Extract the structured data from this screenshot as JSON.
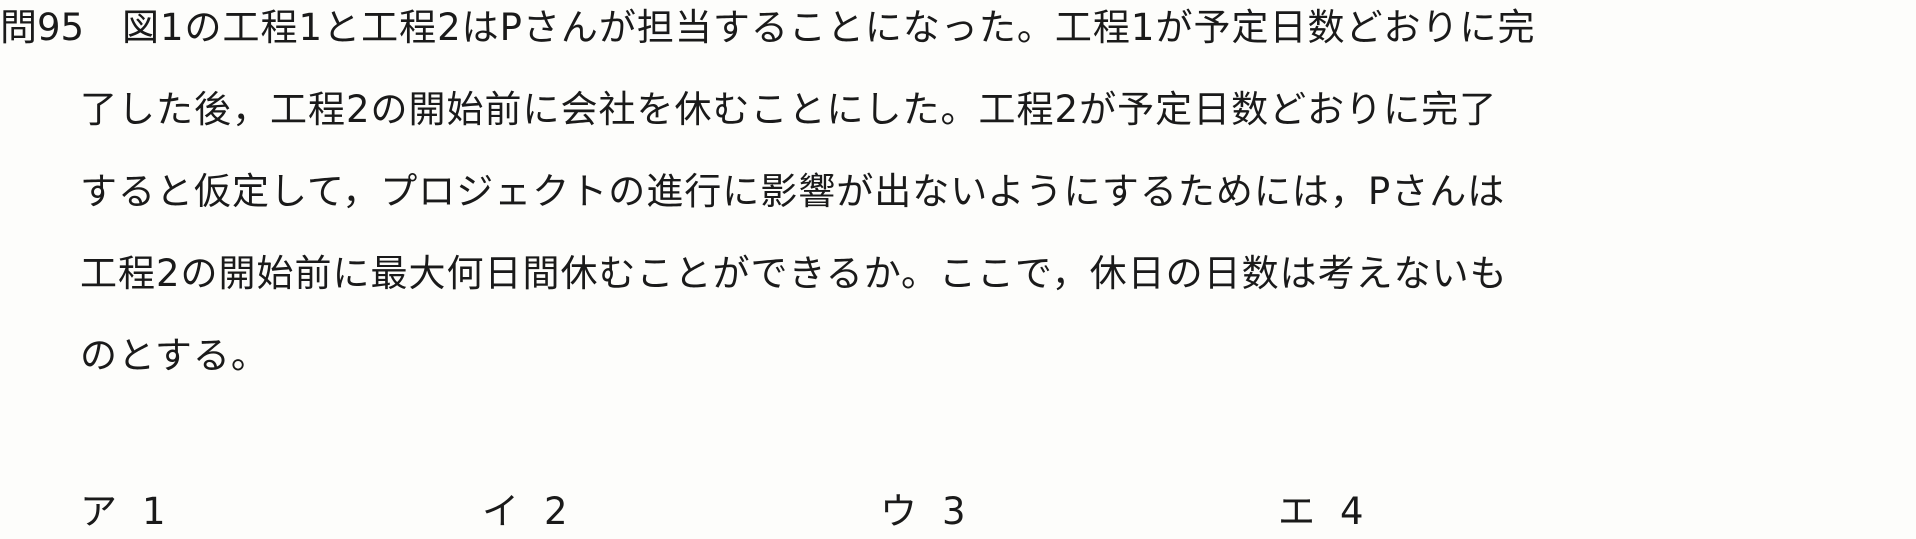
{
  "question": {
    "number": "問95",
    "lines": [
      "図1の工程1と工程2はPさんが担当することになった。工程1が予定日数どおりに完",
      "了した後，工程2の開始前に会社を休むことにした。工程2が予定日数どおりに完了",
      "すると仮定して，プロジェクトの進行に影響が出ないようにするためには，Pさんは",
      "工程2の開始前に最大何日間休むことができるか。ここで，休日の日数は考えないも",
      "のとする。"
    ]
  },
  "choices": [
    {
      "label": "ア",
      "value": "1"
    },
    {
      "label": "イ",
      "value": "2"
    },
    {
      "label": "ウ",
      "value": "3"
    },
    {
      "label": "エ",
      "value": "4"
    }
  ]
}
